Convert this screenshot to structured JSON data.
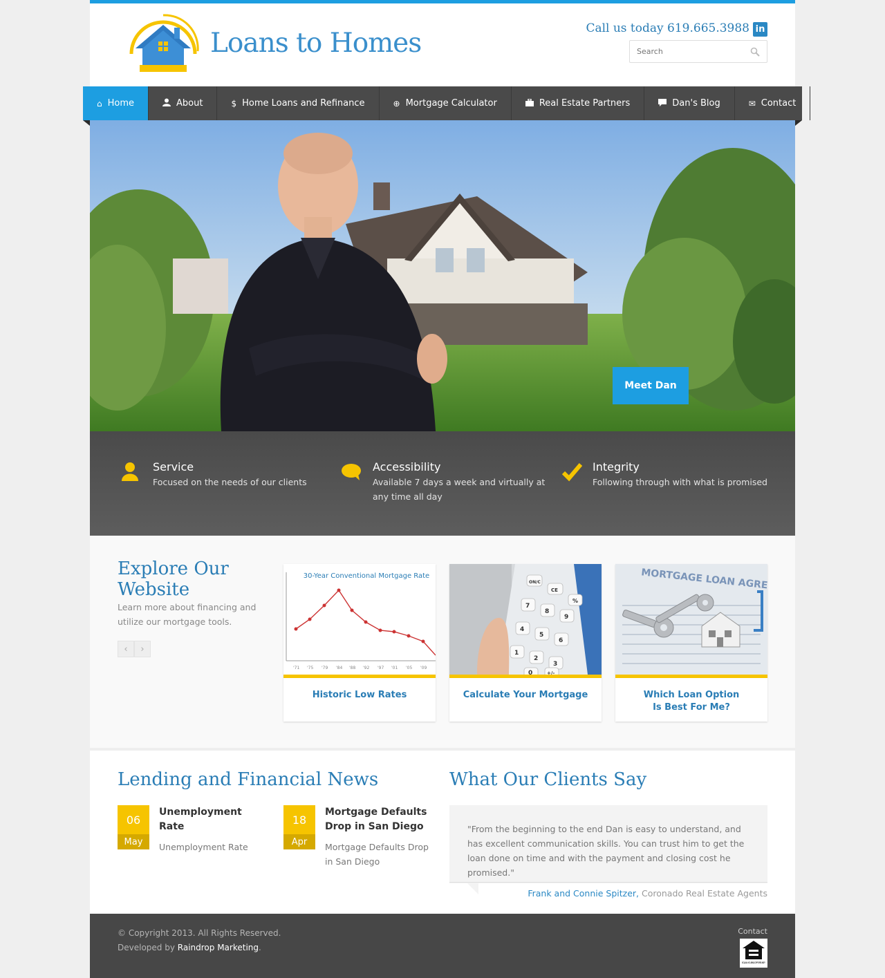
{
  "header": {
    "brand": "Loans to Homes",
    "phone": "Call us today 619.665.3988",
    "linkedin_glyph": "in",
    "search_placeholder": "Search"
  },
  "nav": [
    {
      "label": "Home",
      "icon": "home-icon",
      "glyph": "⌂",
      "active": true
    },
    {
      "label": "About",
      "icon": "user-icon",
      "glyph": "👤"
    },
    {
      "label": "Home Loans and Refinance",
      "icon": "dollar-icon",
      "glyph": "$"
    },
    {
      "label": "Mortgage Calculator",
      "icon": "plus-circle-icon",
      "glyph": "⊕"
    },
    {
      "label": "Real Estate Partners",
      "icon": "briefcase-icon",
      "glyph": "▣"
    },
    {
      "label": "Dan's Blog",
      "icon": "comment-icon",
      "glyph": "▬"
    },
    {
      "label": "Contact",
      "icon": "envelope-icon",
      "glyph": "✉"
    }
  ],
  "hero": {
    "button": "Meet Dan"
  },
  "features": [
    {
      "title": "Service",
      "text": "Focused on the needs of our clients",
      "icon": "user-icon"
    },
    {
      "title": "Accessibility",
      "text": "Available 7 days a week and virtually at any time all day",
      "icon": "chat-bubble-icon"
    },
    {
      "title": "Integrity",
      "text": "Following through with what is promised",
      "icon": "checkmark-icon"
    }
  ],
  "explore": {
    "title": "Explore Our Website",
    "subtitle": "Learn more about financing and utilize our mortgage tools.",
    "prev": "‹",
    "next": "›",
    "cards": [
      {
        "label": "Historic Low Rates",
        "chart_title": "30-Year Conventional Mortgage Rate",
        "ticks": [
          "'71",
          "'75",
          "'79",
          "'84",
          "'88",
          "'92",
          "'97",
          "'01",
          "'05",
          "'09"
        ]
      },
      {
        "label": "Calculate Your Mortgage",
        "keys": [
          "ON/C",
          "CE",
          "%",
          "7",
          "8",
          "9",
          "4",
          "5",
          "6",
          "1",
          "2",
          "3",
          "0",
          "+/-"
        ]
      },
      {
        "label": "Which Loan Option Is Best For Me?",
        "doc_text": "MORTGAGE LOAN AGREEMENT"
      }
    ]
  },
  "news": {
    "title": "Lending and Financial News",
    "items": [
      {
        "day": "06",
        "month": "May",
        "title": "Unemployment Rate",
        "summary": "Unemployment Rate"
      },
      {
        "day": "18",
        "month": "Apr",
        "title": "Mortgage Defaults Drop in San Diego",
        "summary": "Mortgage Defaults Drop in San Diego"
      }
    ]
  },
  "testimonials": {
    "title": "What Our Clients Say",
    "quote": "\"From the beginning to the end Dan is easy to understand, and has excellent communication skills. You can trust him to get the loan done on time and with the payment and closing cost he promised.\"",
    "author": "Frank and Connie Spitzer,",
    "role": "Coronado Real Estate Agents"
  },
  "footer": {
    "copyright": "© Copyright 2013. All Rights Reserved.",
    "developed_by": "Developed by",
    "developer": "Raindrop Marketing",
    "period": ".",
    "contact": "Contact",
    "eho_text": "EQUAL HOUSING OPPORTUNITY"
  },
  "colors": {
    "accent": "#1d9ee1",
    "brand_blue": "#2a7db5",
    "yellow": "#f6c400",
    "nav_bg": "#4a4a4a",
    "footer_bg": "#474747"
  }
}
